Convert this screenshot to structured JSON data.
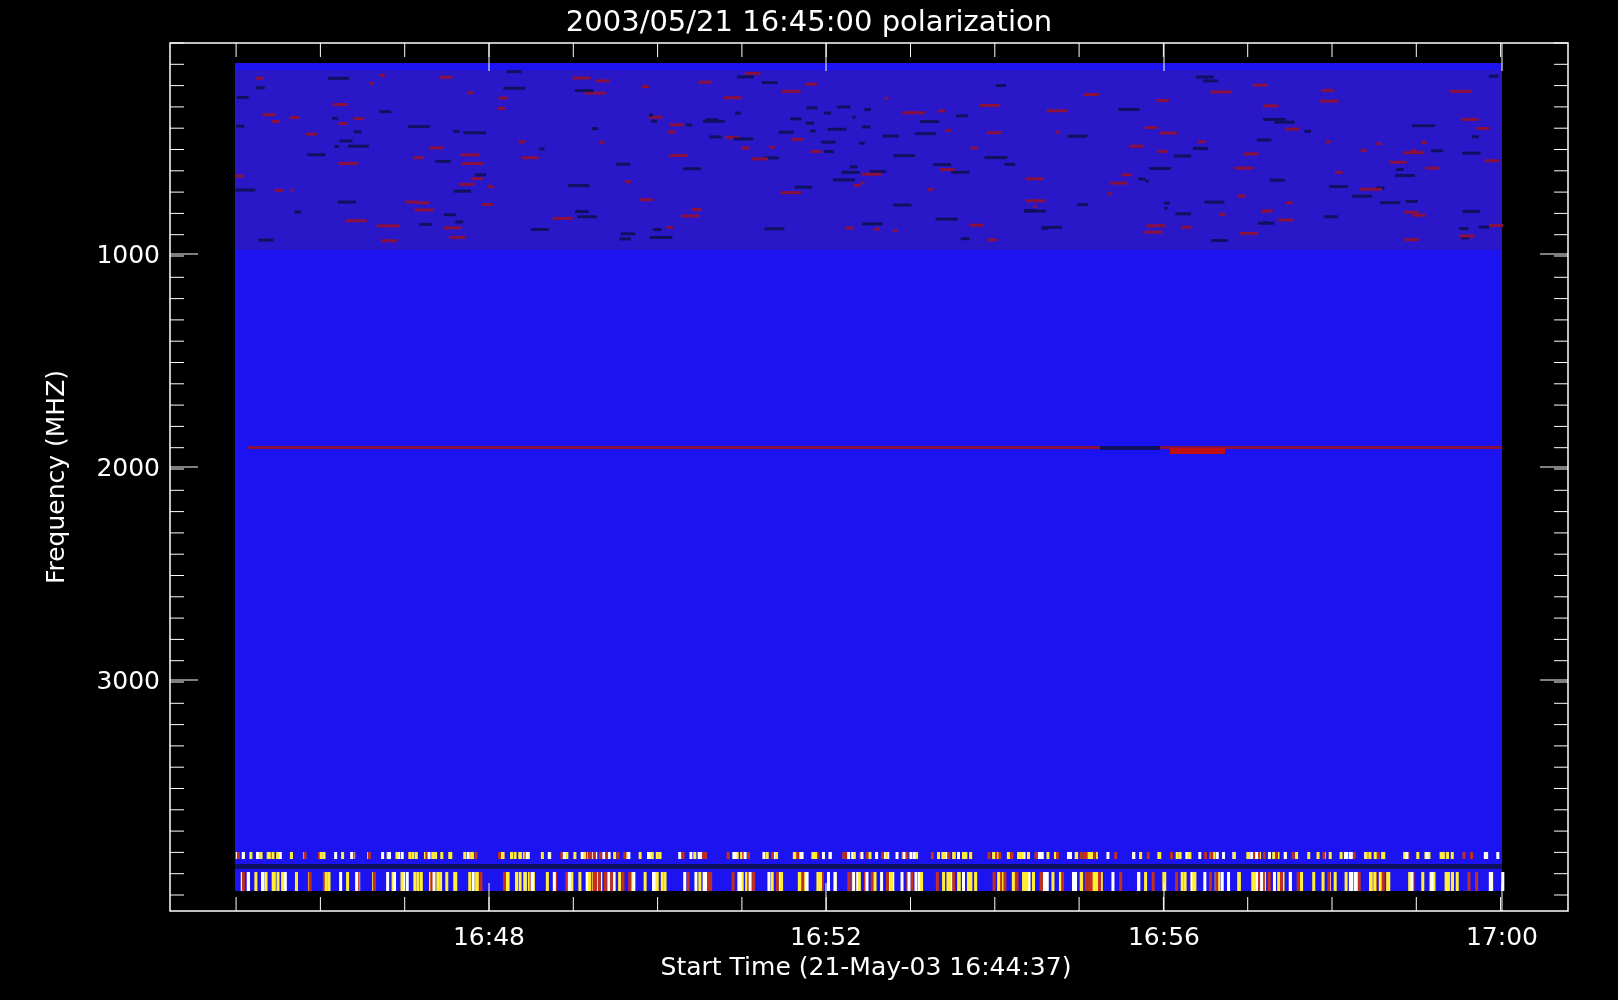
{
  "title": "2003/05/21 16:45:00 polarization",
  "y_axis": {
    "label": "Frequency (MHZ)",
    "ticks": [
      "1000",
      "2000",
      "3000"
    ]
  },
  "x_axis": {
    "label": "Start Time (21-May-03 16:44:37)",
    "ticks": [
      "16:48",
      "16:52",
      "16:56",
      "17:00"
    ]
  }
}
